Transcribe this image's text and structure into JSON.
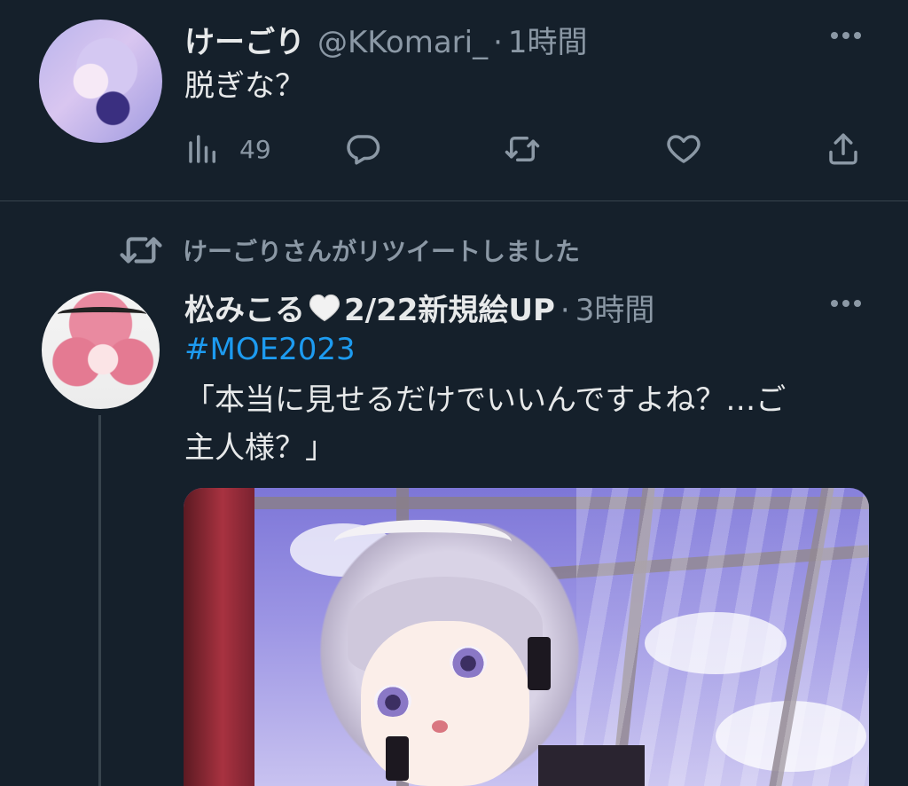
{
  "tweet1": {
    "display_name": "けーごり",
    "handle": "@KKomari_",
    "separator": "·",
    "time": "1時間",
    "text": "脱ぎな？",
    "actions": {
      "views_icon": "bar-chart-icon",
      "views_count": "49",
      "reply_icon": "reply-icon",
      "retweet_icon": "retweet-icon",
      "like_icon": "heart-icon",
      "share_icon": "share-icon"
    }
  },
  "retweet_notice": {
    "icon": "retweet-icon",
    "text": "けーごりさんがリツイートしました"
  },
  "tweet2": {
    "display_name_part1": "松みこる",
    "display_name_emoji": "white-heart-emoji",
    "display_name_part2": "2/22新規絵UP",
    "separator": "·",
    "time": "3時間",
    "hashtag": "#MOE2023",
    "text_line1": "「本当に見せるだけでいいんですよね？…ご",
    "text_line2": "主人様？」",
    "media": "illustration of a maid girl with lavender twin-tail hair by a window"
  },
  "colors": {
    "background": "#15202b",
    "primary_text": "#e7e9ea",
    "secondary_text": "#8b98a5",
    "link": "#1d9bf0",
    "divider": "#38444d"
  }
}
